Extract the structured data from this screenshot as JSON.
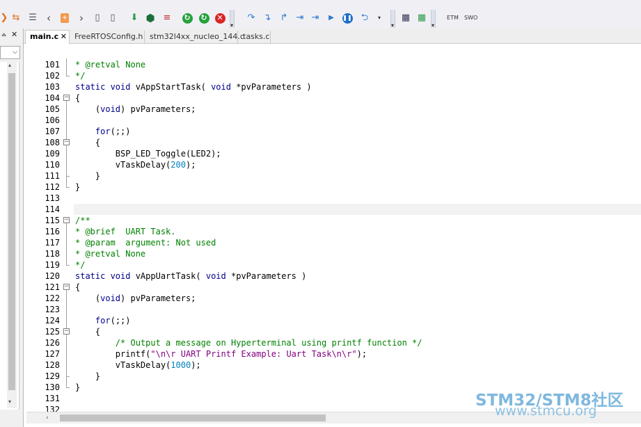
{
  "tabs": [
    {
      "label": "main.c",
      "active": true,
      "close": "✕"
    },
    {
      "label": "FreeRTOSConfig.h",
      "active": false
    },
    {
      "label": "stm32l4xx_nucleo_144.c",
      "active": false
    },
    {
      "label": "tasks.c",
      "active": false
    }
  ],
  "toolbar": {
    "etm_label": "ETM",
    "swo_label": "SWO",
    "icons": [
      "arrow-icon",
      "swap-icon",
      "indent-icon",
      "back-icon",
      "bookmark-icon",
      "forward-icon",
      "page-prev-icon",
      "page-next-icon",
      "download-icon",
      "hex-icon",
      "list-icon",
      "reset-icon",
      "run-icon",
      "stop-icon",
      "step-over-icon",
      "step-into-icon",
      "step-out-icon",
      "run-to-cursor-icon",
      "show-next-icon",
      "start-icon",
      "pause-icon",
      "return-icon",
      "windows-icon",
      "windows2-icon"
    ]
  },
  "left_panel": {
    "pin": "ᅀ",
    "close": "✕",
    "combo_arrow": "⌵"
  },
  "editor": {
    "lines": [
      {
        "n": "101",
        "segs": [
          {
            "t": "* @retval None",
            "c": "cm"
          }
        ]
      },
      {
        "n": "102",
        "segs": [
          {
            "t": "*/",
            "c": "cm"
          }
        ]
      },
      {
        "n": "103",
        "segs": [
          {
            "t": "static void",
            "c": "kw"
          },
          {
            "t": " vAppStartTask( ",
            "c": ""
          },
          {
            "t": "void",
            "c": "kw"
          },
          {
            "t": " *pvParameters )",
            "c": ""
          }
        ]
      },
      {
        "n": "104",
        "segs": [
          {
            "t": "{",
            "c": ""
          }
        ]
      },
      {
        "n": "105",
        "segs": [
          {
            "t": "    (",
            "c": ""
          },
          {
            "t": "void",
            "c": "kw"
          },
          {
            "t": ") pvParameters;",
            "c": ""
          }
        ]
      },
      {
        "n": "106",
        "segs": []
      },
      {
        "n": "107",
        "segs": [
          {
            "t": "    ",
            "c": ""
          },
          {
            "t": "for",
            "c": "kw"
          },
          {
            "t": "(;;)",
            "c": ""
          }
        ]
      },
      {
        "n": "108",
        "segs": [
          {
            "t": "    {",
            "c": ""
          }
        ]
      },
      {
        "n": "109",
        "segs": [
          {
            "t": "        BSP_LED_Toggle(LED2);",
            "c": ""
          }
        ]
      },
      {
        "n": "110",
        "segs": [
          {
            "t": "        vTaskDelay(",
            "c": ""
          },
          {
            "t": "200",
            "c": "num"
          },
          {
            "t": ");",
            "c": ""
          }
        ]
      },
      {
        "n": "111",
        "segs": [
          {
            "t": "    }",
            "c": ""
          }
        ]
      },
      {
        "n": "112",
        "segs": [
          {
            "t": "}",
            "c": ""
          }
        ]
      },
      {
        "n": "113",
        "segs": []
      },
      {
        "n": "114",
        "segs": []
      },
      {
        "n": "115",
        "segs": [
          {
            "t": "/**",
            "c": "cm"
          }
        ]
      },
      {
        "n": "116",
        "segs": [
          {
            "t": "* @brief  UART Task.",
            "c": "cm"
          }
        ]
      },
      {
        "n": "117",
        "segs": [
          {
            "t": "* @param  argument: Not used",
            "c": "cm"
          }
        ]
      },
      {
        "n": "118",
        "segs": [
          {
            "t": "* @retval None",
            "c": "cm"
          }
        ]
      },
      {
        "n": "119",
        "segs": [
          {
            "t": "*/",
            "c": "cm"
          }
        ]
      },
      {
        "n": "120",
        "segs": [
          {
            "t": "static void",
            "c": "kw"
          },
          {
            "t": " vAppUartTask( ",
            "c": ""
          },
          {
            "t": "void",
            "c": "kw"
          },
          {
            "t": " *pvParameters )",
            "c": ""
          }
        ]
      },
      {
        "n": "121",
        "segs": [
          {
            "t": "{",
            "c": ""
          }
        ]
      },
      {
        "n": "122",
        "segs": [
          {
            "t": "    (",
            "c": ""
          },
          {
            "t": "void",
            "c": "kw"
          },
          {
            "t": ") pvParameters;",
            "c": ""
          }
        ]
      },
      {
        "n": "123",
        "segs": []
      },
      {
        "n": "124",
        "segs": [
          {
            "t": "    ",
            "c": ""
          },
          {
            "t": "for",
            "c": "kw"
          },
          {
            "t": "(;;)",
            "c": ""
          }
        ]
      },
      {
        "n": "125",
        "segs": [
          {
            "t": "    {",
            "c": ""
          }
        ]
      },
      {
        "n": "126",
        "segs": [
          {
            "t": "        /* Output a message on Hyperterminal using printf function */",
            "c": "cm"
          }
        ]
      },
      {
        "n": "127",
        "segs": [
          {
            "t": "        printf(",
            "c": ""
          },
          {
            "t": "\"\\n\\r UART Printf Example: Uart Task\\n\\r\"",
            "c": "str"
          },
          {
            "t": ");",
            "c": ""
          }
        ]
      },
      {
        "n": "128",
        "segs": [
          {
            "t": "        vTaskDelay(",
            "c": ""
          },
          {
            "t": "1000",
            "c": "num"
          },
          {
            "t": ");",
            "c": ""
          }
        ]
      },
      {
        "n": "129",
        "segs": [
          {
            "t": "    }",
            "c": ""
          }
        ]
      },
      {
        "n": "130",
        "segs": [
          {
            "t": "}",
            "c": ""
          }
        ]
      },
      {
        "n": "131",
        "segs": []
      },
      {
        "n": "132",
        "segs": []
      }
    ],
    "highlighted_line": "114",
    "fold_open": [
      "104",
      "108",
      "115",
      "121",
      "125"
    ],
    "fold_open_symbol": "−"
  },
  "hscroll": {
    "left_arrow": "‹"
  },
  "watermark": {
    "main": "STM32/STM8社区",
    "url": "www.stmcu.org"
  },
  "colors": {
    "keyword": "#00008b",
    "comment": "#008000",
    "number": "#0080c0",
    "string": "#800080"
  }
}
